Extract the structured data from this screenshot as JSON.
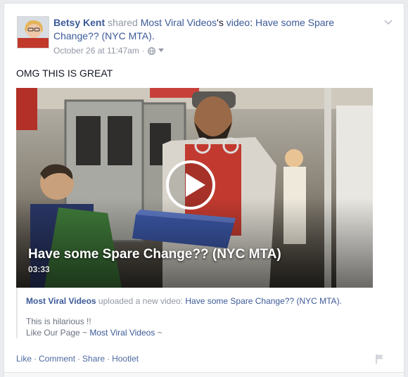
{
  "post": {
    "author": "Betsy Kent",
    "shared_text": " shared ",
    "page_name": "Most Viral Videos",
    "possessive": "'s ",
    "video_word": "video",
    "colon": ": ",
    "video_link_title": "Have some Spare Change?? (NYC MTA).",
    "timestamp": "October 26 at 11:47am",
    "dot": "·",
    "message": "OMG THIS IS GREAT"
  },
  "video": {
    "title": "Have some Spare Change?? (NYC MTA)",
    "duration": "03:33"
  },
  "attachment": {
    "source": "Most Viral Videos",
    "uploaded_text": " uploaded a new video: ",
    "video_title": "Have some Spare Change?? (NYC MTA).",
    "description": "This is hilarious !!",
    "like_prefix": "Like Our Page ~ ",
    "like_page": "Most Viral Videos",
    "like_suffix": " ~"
  },
  "actions": {
    "like": "Like",
    "comment": "Comment",
    "share": "Share",
    "hootlet": "Hootlet",
    "sep": "·"
  },
  "colors": {
    "link": "#3b5998",
    "muted": "#9197a3",
    "action": "#4e69a2"
  },
  "icons": {
    "menu": "chevron-down-icon",
    "privacy": "globe-icon",
    "play": "play-icon",
    "report": "flag-icon"
  }
}
